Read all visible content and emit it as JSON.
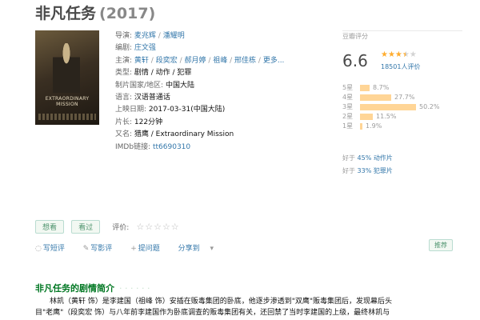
{
  "movie": {
    "title": "非凡任务",
    "year": "(2017)"
  },
  "poster": {
    "text_line1": "EXTRAORDINARY",
    "text_line2": "MISSION"
  },
  "info": {
    "director_label": "导演:",
    "directors": [
      "麦兆辉",
      "潘耀明"
    ],
    "writer_label": "编剧:",
    "writer": "庄文强",
    "cast_label": "主演:",
    "cast": [
      "黄轩",
      "段奕宏",
      "郝月婷",
      "祖峰",
      "邢佳栋"
    ],
    "cast_more": "更多...",
    "genre_label": "类型:",
    "genres": "剧情 / 动作 / 犯罪",
    "region_label": "制片国家/地区:",
    "region": "中国大陆",
    "language_label": "语言:",
    "language": "汉语普通话",
    "release_label": "上映日期:",
    "release": "2017-03-31(中国大陆)",
    "runtime_label": "片长:",
    "runtime": "122分钟",
    "aka_label": "又名:",
    "aka": "猎鹰 / Extraordinary Mission",
    "imdb_label": "IMDb链接:",
    "imdb": "tt6690310"
  },
  "rating": {
    "header": "豆瓣评分",
    "score": "6.6",
    "stars_filled": 3.5,
    "votes": "18501人评价",
    "breakdown": [
      {
        "label": "5星",
        "pct": "8.7%",
        "value": 8.7
      },
      {
        "label": "4星",
        "pct": "27.7%",
        "value": 27.7
      },
      {
        "label": "3星",
        "pct": "50.2%",
        "value": 50.2
      },
      {
        "label": "2星",
        "pct": "11.5%",
        "value": 11.5
      },
      {
        "label": "1星",
        "pct": "1.9%",
        "value": 1.9
      }
    ],
    "better": [
      {
        "prefix": "好于",
        "pct": "45%",
        "genre": "动作片"
      },
      {
        "prefix": "好于",
        "pct": "33%",
        "genre": "犯罪片"
      }
    ]
  },
  "actions": {
    "want": "想看",
    "seen": "看过",
    "rate_label": "评价:",
    "empty_stars": "☆☆☆☆☆"
  },
  "links": {
    "short_review": "写短评",
    "review": "写影评",
    "question": "提问题",
    "share": "分享到"
  },
  "recommend": "推荐",
  "section": {
    "title": "非凡任务的剧情简介",
    "dots": "· · · · · ·"
  },
  "intro": {
    "line1": "林凯（黄轩 饰）是李建国（祖峰 饰）安插在贩毒集团的卧底，他逐步渗透到\"双鹰\"贩毒集团后，发现幕后头",
    "line2": "目\"老鹰\"（段奕宏 饰）与八年前李建国作为卧底调查的贩毒集团有关，还回禁了当时李建国的上级，最终林凯与"
  },
  "colors": {
    "link": "#3377aa",
    "green": "#007722",
    "star": "#ffac2d",
    "bar": "#ffd596"
  }
}
